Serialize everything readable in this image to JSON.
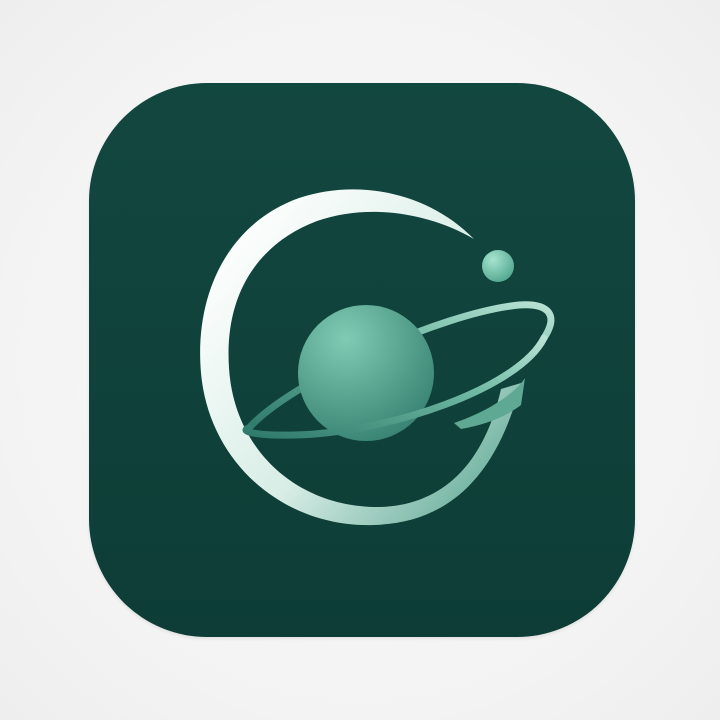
{
  "icon": {
    "name": "planet-orbit-app-icon",
    "colors": {
      "background_top": "#12473f",
      "background_bottom": "#0d3d36",
      "planet_light": "#7fcbb3",
      "planet_dark": "#2f7a6a",
      "crescent_light": "#ffffff",
      "crescent_dark": "#5fa894",
      "moon": "#7fd0b8",
      "page_background": "#f7f7f7"
    }
  }
}
